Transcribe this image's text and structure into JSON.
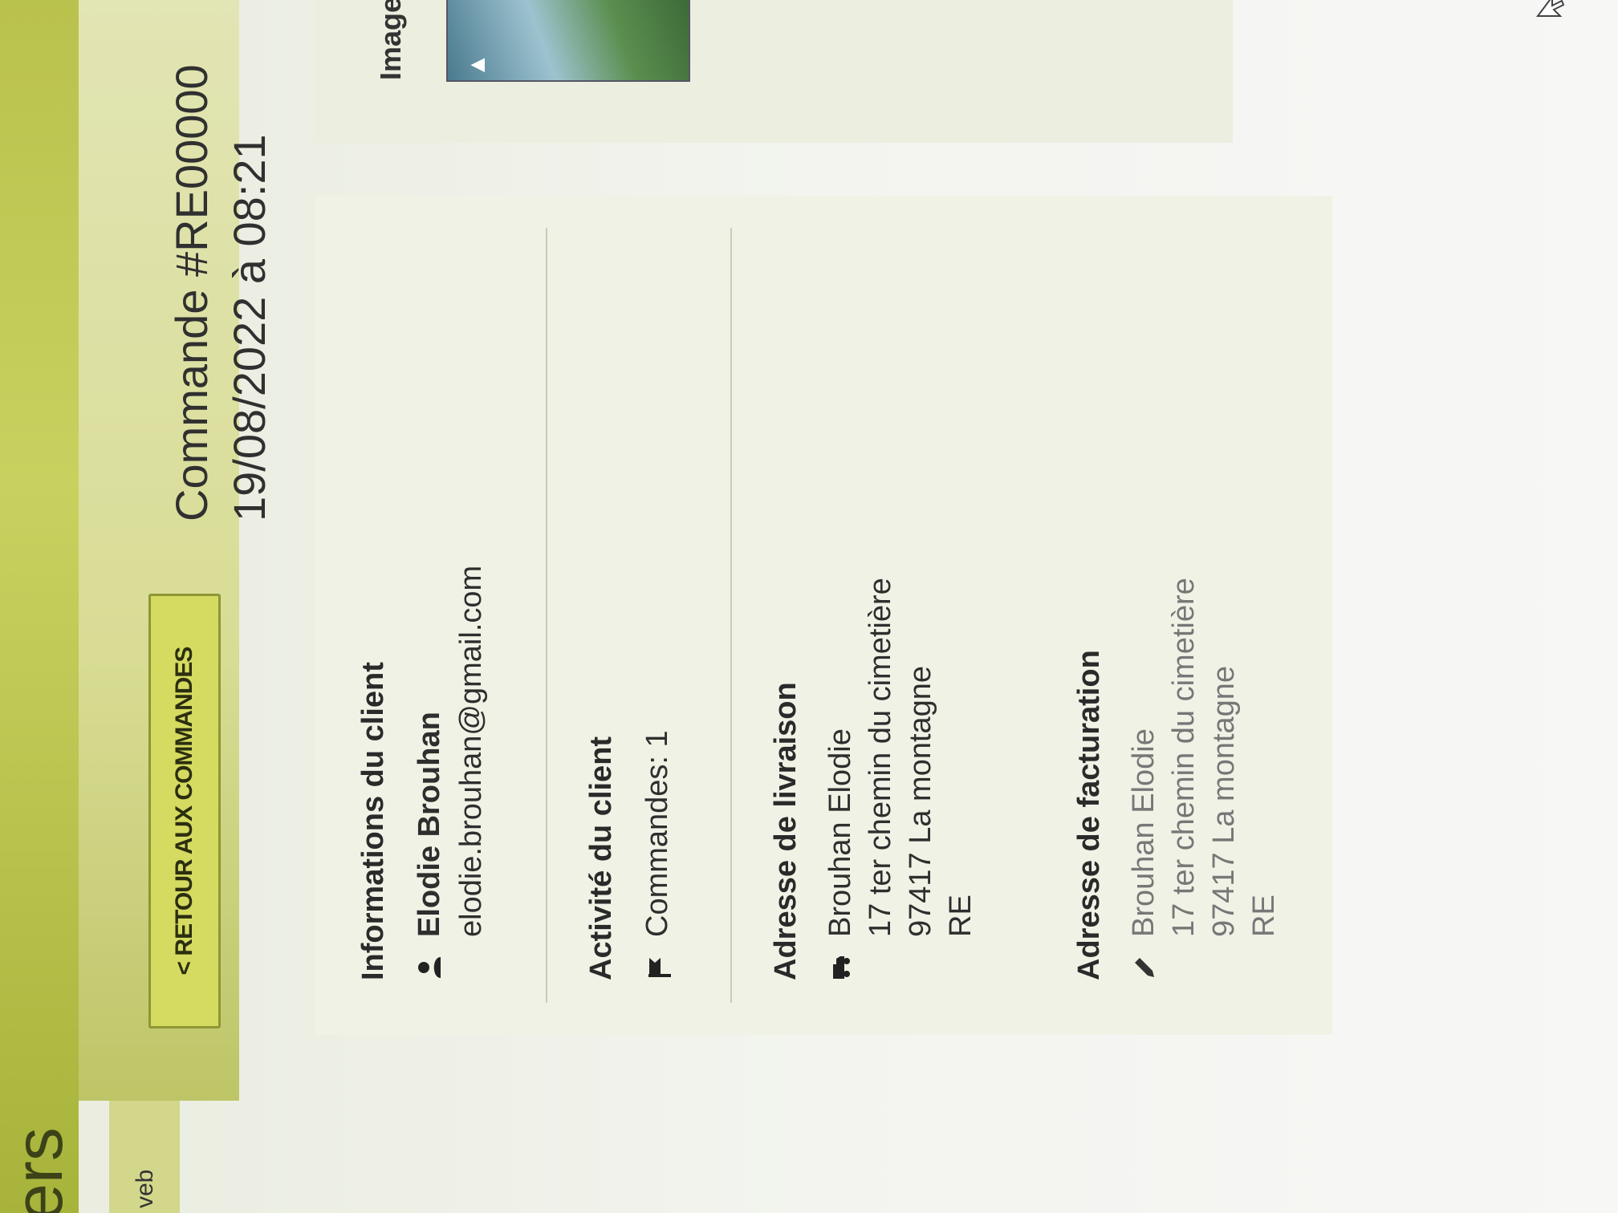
{
  "header": {
    "app_title": "ers",
    "web_tab": "veb"
  },
  "toolbar": {
    "back_label": "< RETOUR AUX COMMANDES"
  },
  "order": {
    "title": "Commande #RE00000",
    "date": "19/08/2022 à 08:21"
  },
  "client_info": {
    "heading": "Informations du client",
    "name": "Elodie Brouhan",
    "email": "elodie.brouhan@gmail.com",
    "icon": "user-icon"
  },
  "client_activity": {
    "heading": "Activité du client",
    "orders": "Commandes: 1",
    "icon": "flag-icon"
  },
  "shipping_address": {
    "heading": "Adresse de livraison",
    "icon": "truck-icon",
    "lines": [
      "Brouhan Elodie",
      "17 ter chemin du cimetière",
      "97417 La montagne",
      "RE"
    ]
  },
  "billing_address": {
    "heading": "Adresse de facturation",
    "icon": "pencil-icon",
    "lines": [
      "Brouhan Elodie",
      "17 ter chemin du cimetière",
      "97417 La montagne",
      "RE"
    ]
  },
  "items_table": {
    "image_header": "Image",
    "product_image": "game-cover-thumbnail"
  },
  "colors": {
    "accent": "#d4db60",
    "header_band": "#b9c24c"
  }
}
